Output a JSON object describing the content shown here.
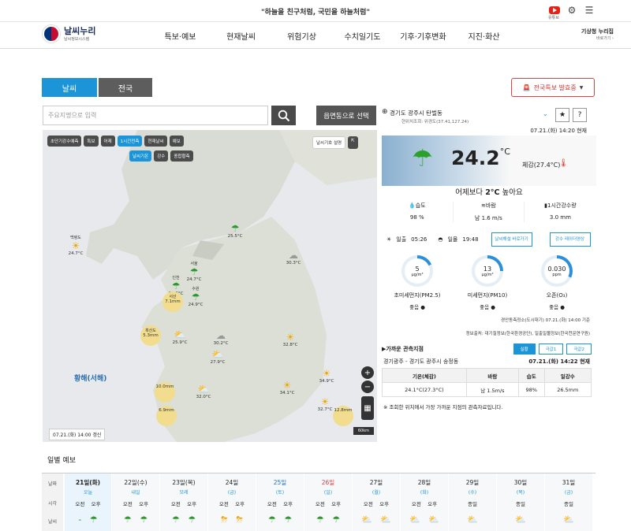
{
  "header": {
    "slogan": "\"하늘을 친구처럼, 국민을 하늘처럼\"",
    "youtube_label": "유튜브"
  },
  "gnb": {
    "logo_title": "날씨누리",
    "logo_sub": "날씨정보시스템",
    "menu": [
      "특보·예보",
      "현재날씨",
      "위험기상",
      "수치일기도",
      "기후·기후변화",
      "지진·화산"
    ],
    "right_title": "기상청 누리집",
    "right_sub": "바로가기 ›"
  },
  "tabs": {
    "weather": "날씨",
    "nation": "전국"
  },
  "alert_label": "전국특보 발효중",
  "search": {
    "placeholder": "주요지명으로 입력",
    "dong_button": "읍면동으로 선택"
  },
  "map": {
    "chips_row1": [
      "초단기강수예측",
      "특보",
      "어제",
      "1시간전측",
      "현재날씨",
      "예보"
    ],
    "chips_row2": [
      "날씨기온",
      "강수",
      "종합황측"
    ],
    "legend_btn": "날씨기호 설명",
    "sea_label": "황해(서해)",
    "time": "07.21.(화) 14:00 갱신",
    "scale": "60km",
    "cities": [
      {
        "name": "백령도",
        "temp": "24.7°C",
        "icon": "☀"
      },
      {
        "name": "",
        "temp": "25.5°C",
        "icon": "☂"
      },
      {
        "name": "",
        "temp": "30.3°C",
        "icon": "☁"
      },
      {
        "name": "서울",
        "temp": "24.7°C",
        "icon": "☂"
      },
      {
        "name": "인천",
        "temp": "24.6°C",
        "icon": "☂"
      },
      {
        "name": "수원",
        "temp": "24.9°C",
        "icon": "☂"
      },
      {
        "name": "서산",
        "temp": "7.1mm",
        "icon": "☂"
      },
      {
        "name": "흑산도",
        "temp": "5.3mm",
        "icon": "☂"
      },
      {
        "name": "",
        "temp": "25.9°C",
        "icon": "⛅"
      },
      {
        "name": "",
        "temp": "30.2°C",
        "icon": "☁"
      },
      {
        "name": "",
        "temp": "32.8°C",
        "icon": "☀"
      },
      {
        "name": "",
        "temp": "27.9°C",
        "icon": "⛅"
      },
      {
        "name": "",
        "temp": "34.1°C",
        "icon": "☀"
      },
      {
        "name": "",
        "temp": "34.9°C",
        "icon": "☀"
      },
      {
        "name": "",
        "temp": "32.0°C",
        "icon": "⛅"
      },
      {
        "name": "",
        "temp": "32.7°C",
        "icon": "☀"
      },
      {
        "name": "",
        "temp": "12.8mm",
        "icon": "☂"
      },
      {
        "name": "",
        "temp": "6.9mm",
        "icon": "☂"
      },
      {
        "name": "",
        "temp": "10.0mm",
        "icon": "☂"
      }
    ]
  },
  "location": {
    "name": "경기도 광주시 탄벌동",
    "coord": "현위치조회: 위경도(37.41,127.24)",
    "obs_time": "07.21.(화) 14:20 현재"
  },
  "current": {
    "temp": "24.2",
    "unit": "°C",
    "feel": "체감(27.4°C)",
    "compare_pre": "어제보다 ",
    "compare_val": "2°C",
    "compare_post": " 높아요",
    "humidity_label": "습도",
    "humidity": "98 %",
    "wind_label": "바람",
    "wind": "남 1.6 m/s",
    "rain_label": "1시간강수량",
    "rain": "3.0 mm",
    "sunrise_label": "일출",
    "sunrise": "05:26",
    "sunset_label": "일몰",
    "sunset": "19:48",
    "btn1": "날씨해설 바로가기",
    "btn2": "강수 레이더영상"
  },
  "dust": [
    {
      "value": "5",
      "unit": "μg/m³",
      "label": "초미세먼지(PM2.5)",
      "grade": "좋음"
    },
    {
      "value": "13",
      "unit": "μg/m³",
      "label": "미세먼지(PM10)",
      "grade": "좋음"
    },
    {
      "value": "0.030",
      "unit": "ppm",
      "label": "오존(O₃)",
      "grade": "좋음"
    }
  ],
  "dust_source": "경안동측정소(도시대기) 07.21.(화) 14:00 기준",
  "info_source": "정보출처: 대기질정보(한국환경공단), 일출일몰정보(한국천문연구원)",
  "near": {
    "title": "가까운 관측지점",
    "tabs": [
      "실황",
      "극값1",
      "극값2"
    ],
    "loc": "경기광주 - 경기도 광주시 송정동",
    "time": "07.21.(화) 14:22 현재",
    "headers": [
      "기온(체감)",
      "바람",
      "습도",
      "일강수"
    ],
    "row": [
      "24.1°C(27.3°C)",
      "남 1.5m/s",
      "98%",
      "26.5mm"
    ],
    "note": "※ 조회한 위치에서 가장 가까운 지점의 관측자료입니다."
  },
  "daily": {
    "title": "일별 예보",
    "row_labels": [
      "날짜",
      "시각",
      "날씨"
    ],
    "am": "오전",
    "pm": "오후",
    "allday": "종일",
    "days": [
      {
        "date": "21일(화)",
        "sub": "오늘",
        "am": "-",
        "pm": "☂"
      },
      {
        "date": "22일(수)",
        "sub": "내일",
        "am": "☂",
        "pm": "☂"
      },
      {
        "date": "23일(목)",
        "sub": "모레",
        "am": "☂",
        "pm": "☂"
      },
      {
        "date": "24일",
        "sub": "(금)",
        "am": "⛈",
        "pm": "⛈"
      },
      {
        "date": "25일",
        "sub": "(토)",
        "am": "☂",
        "pm": "☂"
      },
      {
        "date": "26일",
        "sub": "(일)",
        "am": "☂",
        "pm": "☂"
      },
      {
        "date": "27일",
        "sub": "(월)",
        "am": "⛅",
        "pm": "⛅"
      },
      {
        "date": "28일",
        "sub": "(화)",
        "am": "⛅",
        "pm": "⛅"
      },
      {
        "date": "29일",
        "sub": "(수)",
        "all": "⛅"
      },
      {
        "date": "30일",
        "sub": "(목)",
        "all": "⛅"
      },
      {
        "date": "31일",
        "sub": "(금)",
        "all": "⛅"
      }
    ]
  },
  "colors": {
    "accent": "#1b94d8",
    "alert": "#e54040",
    "ring": "#2c8fdc"
  }
}
